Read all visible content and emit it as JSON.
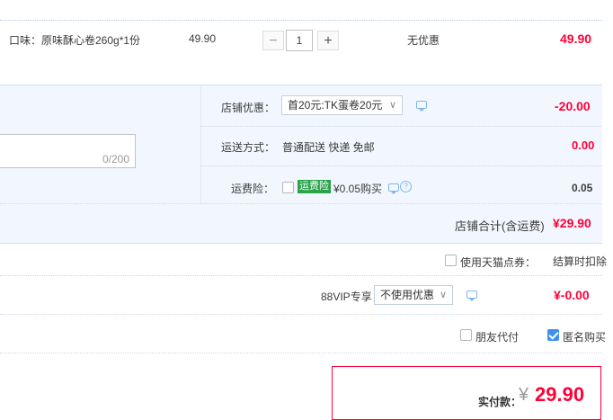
{
  "item": {
    "flavor": "口味：原味酥心卷260g*1份",
    "unit_price": "49.90",
    "quantity": "1",
    "minus": "−",
    "plus": "+",
    "discount": "无优惠",
    "subtotal": "49.90"
  },
  "shop": {
    "coupon_label": "店铺优惠：",
    "coupon_value": "首20元:TK蛋卷20元",
    "coupon_amount": "-20.00",
    "delivery_label": "运送方式：",
    "delivery_value": "普通配送 快递 免邮",
    "delivery_amount": "0.00",
    "insurance_label": "运费险：",
    "insurance_badge": "运费险",
    "insurance_price": "¥0.05购买",
    "insurance_amount": "0.05",
    "message_counter": "0/200",
    "total_label": "店铺合计(含运费)",
    "total_value": "¥29.90"
  },
  "points": {
    "label": "使用天猫点券：",
    "note": "结算时扣除"
  },
  "vip": {
    "label": "88VIP专享",
    "select": "不使用优惠",
    "amount": "¥-0.00"
  },
  "options": {
    "friend_pay": "朋友代付",
    "anonymous": "匿名购买",
    "anonymous_checked": true
  },
  "payment": {
    "label": "实付款：",
    "currency": "¥",
    "amount": "29.90"
  },
  "colors": {
    "accent_red": "#ff0036",
    "light_blue": "#f2f7ff",
    "checkbox_blue": "#3d8ff2"
  }
}
